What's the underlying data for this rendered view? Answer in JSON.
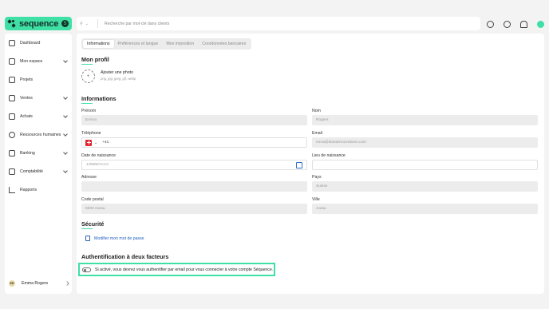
{
  "brand": {
    "name": "sequence",
    "badge": "S"
  },
  "sidebar": {
    "items": [
      {
        "label": "Dashboard",
        "chevron": false
      },
      {
        "label": "Mon espace",
        "chevron": true
      },
      {
        "label": "Projets",
        "chevron": false
      },
      {
        "label": "Ventes",
        "chevron": true
      },
      {
        "label": "Achats",
        "chevron": true
      },
      {
        "label": "Ressources humaines",
        "chevron": true
      },
      {
        "label": "Banking",
        "chevron": true
      },
      {
        "label": "Comptabilité",
        "chevron": true
      },
      {
        "label": "Rapports",
        "chevron": false
      }
    ],
    "user": {
      "initials": "ER",
      "name": "Emma Rogers"
    }
  },
  "search": {
    "scope_icon": "search-icon",
    "placeholder": "Recherche par mot-clé dans clients"
  },
  "tabs": [
    "Informations",
    "Préférences et langue",
    "Mon imposition",
    "Coordonnées bancaires"
  ],
  "profile": {
    "title": "Mon profil",
    "photo_title": "Ajouter une photo",
    "photo_formats": "png, jpg, jpeg, gif, webp"
  },
  "info": {
    "title": "Informations",
    "prenom_label": "Prénom",
    "prenom_value": "Emma",
    "nom_label": "Nom",
    "nom_value": "Rogers",
    "phone_label": "Téléphone",
    "phone_prefix": "+41",
    "email_label": "Email",
    "email_value": "emra@sbsasinnovations.com",
    "birth_label": "Date de naissance",
    "birth_placeholder": "JJ/MM/AAAA",
    "birthplace_label": "Lieu de naissance",
    "address_label": "Adresse",
    "country_label": "Pays",
    "country_value": "Suisse",
    "zip_label": "Code postal",
    "zip_value": "5000 Aarau",
    "city_label": "Ville",
    "city_value": "Aarau"
  },
  "security": {
    "title": "Sécurité",
    "change_password": "Modifier mon mot de passe"
  },
  "twofa": {
    "title": "Authentification à deux facteurs",
    "description": "Si activé, vous devrez vous authentifier par email pour vous connecter à votre compte Séquence.",
    "enabled": false
  },
  "colors": {
    "accent": "#3fe0a5",
    "link": "#1f5fbf",
    "background": "#f3f3f3"
  }
}
